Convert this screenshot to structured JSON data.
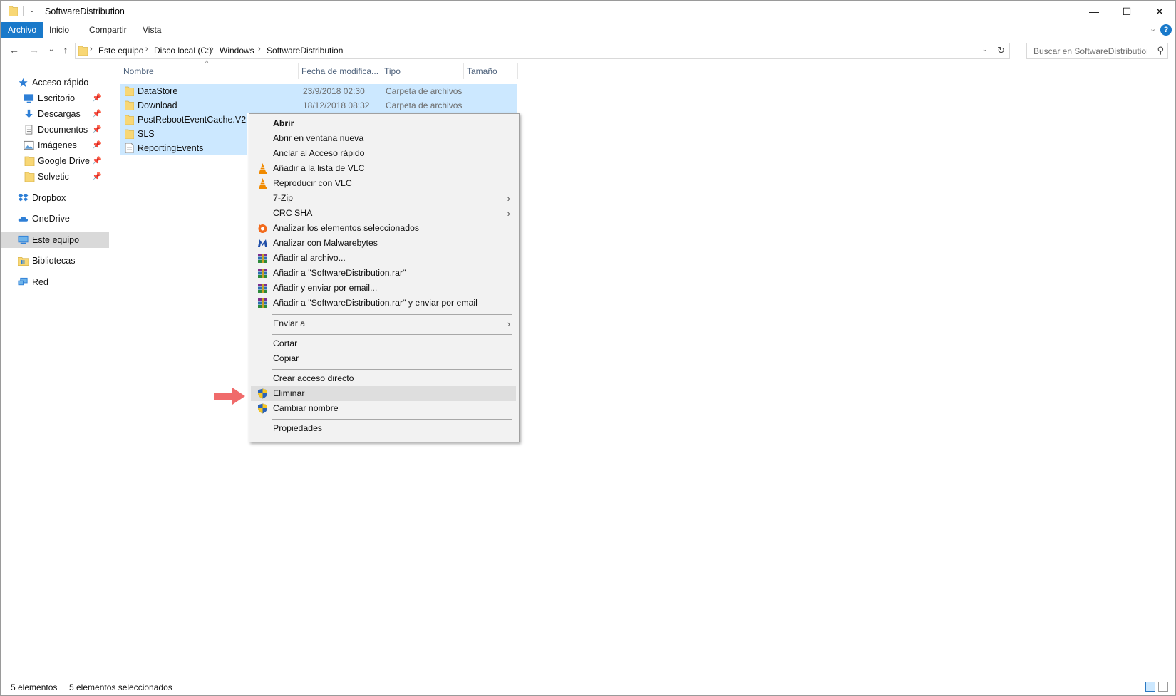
{
  "window": {
    "title": "SoftwareDistribution",
    "minimize_glyph": "—",
    "maximize_glyph": "☐",
    "close_glyph": "✕"
  },
  "ribbon": {
    "tabs": [
      "Archivo",
      "Inicio",
      "Compartir",
      "Vista"
    ],
    "active_tab": "Archivo",
    "expand_glyph": "⌄",
    "help_glyph": "?"
  },
  "address": {
    "back_glyph": "←",
    "forward_glyph": "→",
    "recent_glyph": "⌄",
    "up_glyph": "↑",
    "crumbs": [
      "Este equipo",
      "Disco local (C:)",
      "Windows",
      "SoftwareDistribution"
    ],
    "crumb_sep": "›",
    "dropdown_glyph": "⌄",
    "refresh_glyph": "↻"
  },
  "search": {
    "placeholder": "Buscar en SoftwareDistribution",
    "icon_glyph": "⚲"
  },
  "nav": {
    "pin_glyph": "📌",
    "items": [
      {
        "label": "Acceso rápido",
        "icon": "star-icon",
        "pinned": false
      },
      {
        "label": "Escritorio",
        "icon": "desktop-icon",
        "pinned": true
      },
      {
        "label": "Descargas",
        "icon": "download-icon",
        "pinned": true
      },
      {
        "label": "Documentos",
        "icon": "documents-icon",
        "pinned": true
      },
      {
        "label": "Imágenes",
        "icon": "pictures-icon",
        "pinned": true
      },
      {
        "label": "Google Drive",
        "icon": "folder-icon",
        "pinned": true
      },
      {
        "label": "Solvetic",
        "icon": "folder-icon",
        "pinned": true
      },
      {
        "label": "Dropbox",
        "icon": "dropbox-icon",
        "pinned": false
      },
      {
        "label": "OneDrive",
        "icon": "onedrive-icon",
        "pinned": false
      },
      {
        "label": "Este equipo",
        "icon": "computer-icon",
        "pinned": false,
        "selected": true
      },
      {
        "label": "Bibliotecas",
        "icon": "libraries-icon",
        "pinned": false
      },
      {
        "label": "Red",
        "icon": "network-icon",
        "pinned": false
      }
    ]
  },
  "columns": {
    "name": "Nombre",
    "date": "Fecha de modifica...",
    "type": "Tipo",
    "size": "Tamaño",
    "sort_glyph": "^"
  },
  "files": [
    {
      "name": "DataStore",
      "date": "23/9/2018 02:30",
      "type": "Carpeta de archivos",
      "icon": "folder-icon"
    },
    {
      "name": "Download",
      "date": "18/12/2018 08:32",
      "type": "Carpeta de archivos",
      "icon": "folder-icon"
    },
    {
      "name": "PostRebootEventCache.V2",
      "date": "",
      "type": "",
      "icon": "folder-icon"
    },
    {
      "name": "SLS",
      "date": "",
      "type": "",
      "icon": "folder-icon"
    },
    {
      "name": "ReportingEvents",
      "date": "",
      "type": "",
      "icon": "file-icon"
    }
  ],
  "context_menu": {
    "submenu_glyph": "›",
    "items": [
      {
        "label": "Abrir",
        "bold": true,
        "icon": ""
      },
      {
        "label": "Abrir en ventana nueva",
        "icon": ""
      },
      {
        "label": "Anclar al Acceso rápido",
        "icon": ""
      },
      {
        "label": "Añadir a la lista de VLC",
        "icon": "vlc-icon"
      },
      {
        "label": "Reproducir con VLC",
        "icon": "vlc-icon"
      },
      {
        "label": "7-Zip",
        "icon": "",
        "submenu": true
      },
      {
        "label": "CRC SHA",
        "icon": "",
        "submenu": true
      },
      {
        "label": "Analizar los elementos seleccionados",
        "icon": "avast-icon"
      },
      {
        "label": "Analizar con Malwarebytes",
        "icon": "malwarebytes-icon"
      },
      {
        "label": "Añadir al archivo...",
        "icon": "winrar-icon"
      },
      {
        "label": "Añadir a \"SoftwareDistribution.rar\"",
        "icon": "winrar-icon"
      },
      {
        "label": "Añadir y enviar por email...",
        "icon": "winrar-icon"
      },
      {
        "label": "Añadir a \"SoftwareDistribution.rar\" y enviar por email",
        "icon": "winrar-icon"
      },
      {
        "label": "Enviar a",
        "icon": "",
        "submenu": true
      },
      {
        "label": "Cortar",
        "icon": ""
      },
      {
        "label": "Copiar",
        "icon": ""
      },
      {
        "label": "Crear acceso directo",
        "icon": ""
      },
      {
        "label": "Eliminar",
        "icon": "shield-icon",
        "hover": true
      },
      {
        "label": "Cambiar nombre",
        "icon": "shield-icon"
      },
      {
        "label": "Propiedades",
        "icon": ""
      }
    ]
  },
  "status": {
    "count": "5 elementos",
    "selected": "5 elementos seleccionados"
  },
  "colors": {
    "accent": "#1979ca",
    "selection": "#cce8ff",
    "annotation_arrow": "#f06b6b"
  }
}
